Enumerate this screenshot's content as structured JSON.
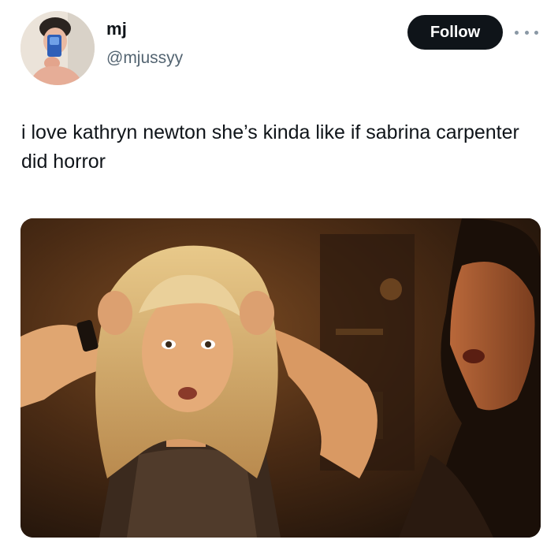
{
  "tweet": {
    "author": {
      "display_name": "mj",
      "handle": "@mjussyy",
      "avatar_icon": "profile-photo"
    },
    "follow_label": "Follow",
    "more_icon": "more-horizontal-icon",
    "text": "i love kathryn newton she’s kinda like if sabrina carpenter did horror",
    "media": {
      "type": "photo"
    }
  },
  "colors": {
    "follow_bg": "#0f1419",
    "follow_text": "#ffffff",
    "handle_text": "#536471",
    "body_text": "#0f1419"
  }
}
